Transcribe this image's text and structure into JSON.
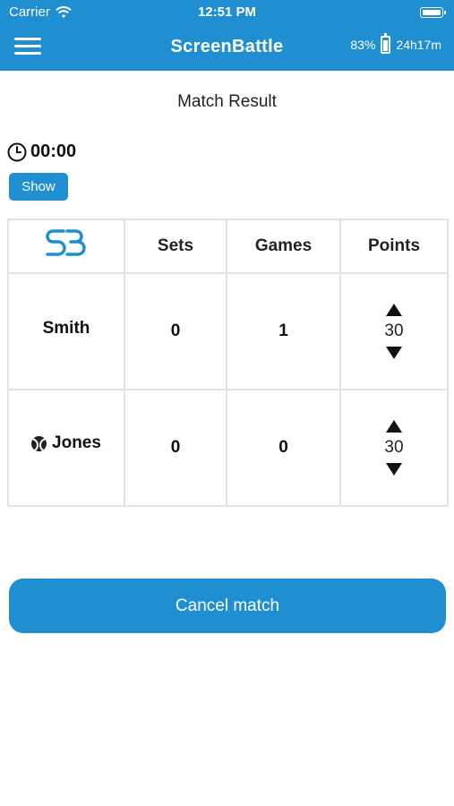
{
  "status_bar": {
    "carrier": "Carrier",
    "time": "12:51 PM"
  },
  "nav": {
    "title": "ScreenBattle",
    "battery_percent": "83%",
    "duration": "24h17m"
  },
  "page": {
    "title": "Match Result",
    "timer": "00:00",
    "show_label": "Show"
  },
  "table": {
    "headers": [
      "Sets",
      "Games",
      "Points"
    ],
    "rows": [
      {
        "player": "Smith",
        "serving": false,
        "sets": "0",
        "games": "1",
        "points": "30"
      },
      {
        "player": "Jones",
        "serving": true,
        "sets": "0",
        "games": "0",
        "points": "30"
      }
    ]
  },
  "actions": {
    "cancel_label": "Cancel match"
  },
  "colors": {
    "brand": "#1f8fd2"
  },
  "icons": [
    "menu-icon",
    "wifi-icon",
    "battery-icon",
    "clock-icon",
    "screenbattle-logo",
    "tennis-ball-icon",
    "arrow-up-icon",
    "arrow-down-icon"
  ]
}
